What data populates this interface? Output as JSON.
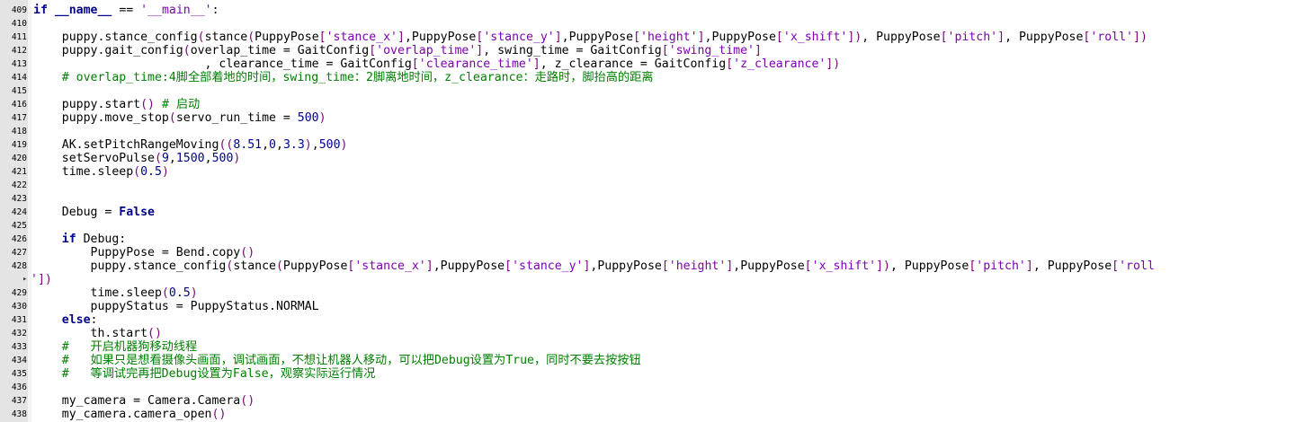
{
  "editor": {
    "lines": [
      {
        "num": "409",
        "tokens": [
          [
            "kw",
            "if"
          ],
          [
            "id",
            " "
          ],
          [
            "kw",
            "__name__"
          ],
          [
            "id",
            " "
          ],
          [
            "op",
            "=="
          ],
          [
            "id",
            " "
          ],
          [
            "str",
            "'__main__'"
          ],
          [
            "op",
            ":"
          ]
        ]
      },
      {
        "num": "410",
        "tokens": []
      },
      {
        "num": "411",
        "tokens": [
          [
            "id",
            "    puppy.stance_config"
          ],
          [
            "bk",
            "("
          ],
          [
            "id",
            "stance"
          ],
          [
            "bk",
            "("
          ],
          [
            "id",
            "PuppyPose"
          ],
          [
            "bk",
            "["
          ],
          [
            "str",
            "'stance_x'"
          ],
          [
            "bk",
            "]"
          ],
          [
            "id",
            ",PuppyPose"
          ],
          [
            "bk",
            "["
          ],
          [
            "str",
            "'stance_y'"
          ],
          [
            "bk",
            "]"
          ],
          [
            "id",
            ",PuppyPose"
          ],
          [
            "bk",
            "["
          ],
          [
            "str",
            "'height'"
          ],
          [
            "bk",
            "]"
          ],
          [
            "id",
            ",PuppyPose"
          ],
          [
            "bk",
            "["
          ],
          [
            "str",
            "'x_shift'"
          ],
          [
            "bk",
            "])"
          ],
          [
            "id",
            ", PuppyPose"
          ],
          [
            "bk",
            "["
          ],
          [
            "str",
            "'pitch'"
          ],
          [
            "bk",
            "]"
          ],
          [
            "id",
            ", PuppyPose"
          ],
          [
            "bk",
            "["
          ],
          [
            "str",
            "'roll'"
          ],
          [
            "bk",
            "])"
          ]
        ]
      },
      {
        "num": "412",
        "tokens": [
          [
            "id",
            "    puppy.gait_config"
          ],
          [
            "bk",
            "("
          ],
          [
            "id",
            "overlap_time = GaitConfig"
          ],
          [
            "bk",
            "["
          ],
          [
            "str",
            "'overlap_time'"
          ],
          [
            "bk",
            "]"
          ],
          [
            "id",
            ", swing_time = GaitConfig"
          ],
          [
            "bk",
            "["
          ],
          [
            "str",
            "'swing_time'"
          ],
          [
            "bk",
            "]"
          ]
        ]
      },
      {
        "num": "413",
        "tokens": [
          [
            "id",
            "                        , clearance_time = GaitConfig"
          ],
          [
            "bk",
            "["
          ],
          [
            "str",
            "'clearance_time'"
          ],
          [
            "bk",
            "]"
          ],
          [
            "id",
            ", z_clearance = GaitConfig"
          ],
          [
            "bk",
            "["
          ],
          [
            "str",
            "'z_clearance'"
          ],
          [
            "bk",
            "])"
          ]
        ]
      },
      {
        "num": "414",
        "tokens": [
          [
            "cm",
            "    # overlap_time:4脚全部着地的时间，swing_time：2脚离地时间，z_clearance：走路时，脚抬高的距离"
          ]
        ]
      },
      {
        "num": "415",
        "tokens": []
      },
      {
        "num": "416",
        "tokens": [
          [
            "id",
            "    puppy.start"
          ],
          [
            "bk",
            "()"
          ],
          [
            "id",
            " "
          ],
          [
            "cm",
            "# 启动"
          ]
        ]
      },
      {
        "num": "417",
        "tokens": [
          [
            "id",
            "    puppy.move_stop"
          ],
          [
            "bk",
            "("
          ],
          [
            "id",
            "servo_run_time = "
          ],
          [
            "num",
            "500"
          ],
          [
            "bk",
            ")"
          ]
        ]
      },
      {
        "num": "418",
        "tokens": []
      },
      {
        "num": "419",
        "tokens": [
          [
            "id",
            "    AK.setPitchRangeMoving"
          ],
          [
            "bk",
            "(("
          ],
          [
            "num",
            "8.51"
          ],
          [
            "id",
            ","
          ],
          [
            "num",
            "0"
          ],
          [
            "id",
            ","
          ],
          [
            "num",
            "3.3"
          ],
          [
            "bk",
            ")"
          ],
          [
            "id",
            ","
          ],
          [
            "num",
            "500"
          ],
          [
            "bk",
            ")"
          ]
        ]
      },
      {
        "num": "420",
        "tokens": [
          [
            "id",
            "    setServoPulse"
          ],
          [
            "bk",
            "("
          ],
          [
            "num",
            "9"
          ],
          [
            "id",
            ","
          ],
          [
            "num",
            "1500"
          ],
          [
            "id",
            ","
          ],
          [
            "num",
            "500"
          ],
          [
            "bk",
            ")"
          ]
        ]
      },
      {
        "num": "421",
        "tokens": [
          [
            "id",
            "    time.sleep"
          ],
          [
            "bk",
            "("
          ],
          [
            "num",
            "0.5"
          ],
          [
            "bk",
            ")"
          ]
        ]
      },
      {
        "num": "422",
        "tokens": []
      },
      {
        "num": "423",
        "tokens": []
      },
      {
        "num": "424",
        "tokens": [
          [
            "id",
            "    Debug = "
          ],
          [
            "kw",
            "False"
          ]
        ]
      },
      {
        "num": "425",
        "tokens": []
      },
      {
        "num": "426",
        "tokens": [
          [
            "id",
            "    "
          ],
          [
            "kw",
            "if"
          ],
          [
            "id",
            " Debug"
          ],
          [
            "op",
            ":"
          ]
        ]
      },
      {
        "num": "427",
        "tokens": [
          [
            "id",
            "        PuppyPose = Bend.copy"
          ],
          [
            "bk",
            "()"
          ]
        ]
      },
      {
        "num": "428",
        "tokens": [
          [
            "id",
            "        puppy.stance_config"
          ],
          [
            "bk",
            "("
          ],
          [
            "id",
            "stance"
          ],
          [
            "bk",
            "("
          ],
          [
            "id",
            "PuppyPose"
          ],
          [
            "bk",
            "["
          ],
          [
            "str",
            "'stance_x'"
          ],
          [
            "bk",
            "]"
          ],
          [
            "id",
            ",PuppyPose"
          ],
          [
            "bk",
            "["
          ],
          [
            "str",
            "'stance_y'"
          ],
          [
            "bk",
            "]"
          ],
          [
            "id",
            ",PuppyPose"
          ],
          [
            "bk",
            "["
          ],
          [
            "str",
            "'height'"
          ],
          [
            "bk",
            "]"
          ],
          [
            "id",
            ",PuppyPose"
          ],
          [
            "bk",
            "["
          ],
          [
            "str",
            "'x_shift'"
          ],
          [
            "bk",
            "])"
          ],
          [
            "id",
            ", PuppyPose"
          ],
          [
            "bk",
            "["
          ],
          [
            "str",
            "'pitch'"
          ],
          [
            "bk",
            "]"
          ],
          [
            "id",
            ", PuppyPose"
          ],
          [
            "bk",
            "["
          ],
          [
            "str",
            "'roll"
          ]
        ]
      },
      {
        "num": "",
        "wrap": true,
        "tokens": [
          [
            "str",
            "'"
          ],
          [
            "bk",
            "])"
          ]
        ]
      },
      {
        "num": "429",
        "tokens": [
          [
            "id",
            "        time.sleep"
          ],
          [
            "bk",
            "("
          ],
          [
            "num",
            "0.5"
          ],
          [
            "bk",
            ")"
          ]
        ]
      },
      {
        "num": "430",
        "tokens": [
          [
            "id",
            "        puppyStatus = PuppyStatus.NORMAL"
          ]
        ]
      },
      {
        "num": "431",
        "tokens": [
          [
            "id",
            "    "
          ],
          [
            "kw",
            "else"
          ],
          [
            "op",
            ":"
          ]
        ]
      },
      {
        "num": "432",
        "tokens": [
          [
            "id",
            "        th.start"
          ],
          [
            "bk",
            "()"
          ]
        ]
      },
      {
        "num": "433",
        "tokens": [
          [
            "cm",
            "    #   开启机器狗移动线程"
          ]
        ]
      },
      {
        "num": "434",
        "tokens": [
          [
            "cm",
            "    #   如果只是想看摄像头画面，调试画面，不想让机器人移动，可以把Debug设置为True，同时不要去按按钮"
          ]
        ]
      },
      {
        "num": "435",
        "tokens": [
          [
            "cm",
            "    #   等调试完再把Debug设置为False，观察实际运行情况"
          ]
        ]
      },
      {
        "num": "436",
        "tokens": []
      },
      {
        "num": "437",
        "tokens": [
          [
            "id",
            "    my_camera = Camera.Camera"
          ],
          [
            "bk",
            "()"
          ]
        ]
      },
      {
        "num": "438",
        "tokens": [
          [
            "id",
            "    my_camera.camera_open"
          ],
          [
            "bk",
            "()"
          ]
        ]
      }
    ]
  }
}
